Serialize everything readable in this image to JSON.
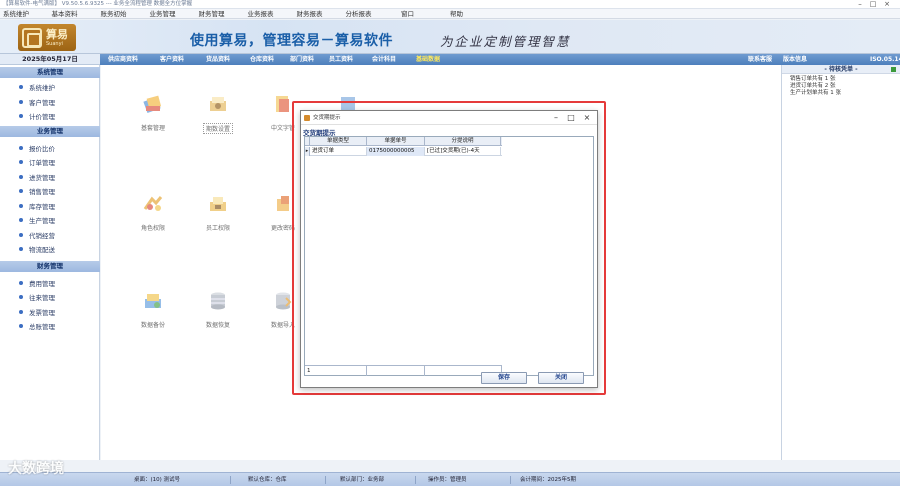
{
  "window": {
    "title": "【算易软件-电气满版】 V9.50.5.6.9325 --- 业务全流程管理 数据全方位掌握"
  },
  "menu": [
    "系统维护",
    "基本资料",
    "账务初始",
    "业务管理",
    "财务管理",
    "业务报表",
    "财务报表",
    "分析报表",
    "窗口",
    "帮助"
  ],
  "logo": {
    "cn": "算易",
    "en": "Suanyi"
  },
  "banner": {
    "slogan": "使用算易，管理容易－算易软件",
    "slogan2": "为企业定制管理智慧"
  },
  "date": "2025年05月17日",
  "nav": {
    "items": [
      "供应商资料",
      "客户资料",
      "货品资料",
      "仓库资料",
      "部门资料",
      "员工资料",
      "会计科目",
      "基础数据"
    ],
    "active_index": 7,
    "right1": "联系客服",
    "right2": "版本信息",
    "right3": "ISO.05.14"
  },
  "sidebar": {
    "sections": [
      {
        "title": "系统管理",
        "items": [
          "系统维护",
          "客户管理",
          "计价管理"
        ]
      },
      {
        "title": "业务管理",
        "items": [
          "报价比价",
          "订单管理",
          "进货管理",
          "销售管理",
          "库存管理",
          "生产管理",
          "代销经营",
          "物流配送"
        ]
      },
      {
        "title": "财务管理",
        "items": [
          "费用管理",
          "往来管理",
          "发票管理",
          "总账管理"
        ]
      }
    ]
  },
  "tiles": [
    {
      "label": "基套管理",
      "icon": "books-icon"
    },
    {
      "label": "期数设置",
      "icon": "settings-icon",
      "boxed": true
    },
    {
      "label": "中文字管",
      "icon": "font-icon"
    },
    {
      "label": "",
      "icon": "folder-icon"
    },
    {
      "label": "角色权限",
      "icon": "role-icon"
    },
    {
      "label": "员工权限",
      "icon": "staff-icon"
    },
    {
      "label": "更改密码",
      "icon": "password-icon"
    },
    {
      "label": "数据备份",
      "icon": "backup-icon"
    },
    {
      "label": "数据恢复",
      "icon": "restore-icon"
    },
    {
      "label": "数据导入",
      "icon": "import-icon"
    }
  ],
  "todo": {
    "title": "- 待核凭单 -",
    "lines": [
      "销售订单共有 1 张",
      "进货订单共有 2 张",
      "生产计划单共有 1 张"
    ]
  },
  "status": {
    "items": [
      "桌面：(10) 测试号",
      "默认仓库：仓库",
      "默认部门：业务部",
      "操作员：管理员",
      "会计期间：2025年5期"
    ]
  },
  "watermark": "大数跨境",
  "dialog": {
    "title": "交货期提示",
    "subtitle": "交货期提示",
    "columns": [
      "单据类型",
      "单据单号",
      "分提说明"
    ],
    "rows": [
      {
        "type": "进货订单",
        "number": "0175000000005",
        "note": "[已过]交货期(已)-4天"
      }
    ],
    "footer_count": "1",
    "save_label": "保存",
    "close_label": "关闭"
  }
}
